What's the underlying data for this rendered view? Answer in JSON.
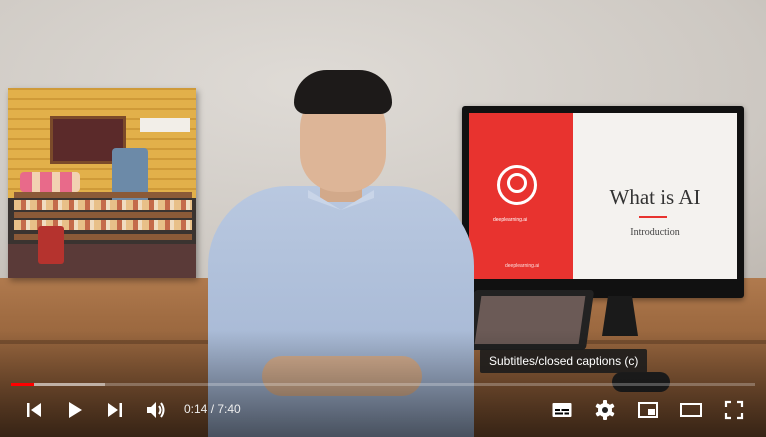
{
  "slide": {
    "brand": "deeplearning.ai",
    "footer": "deeplearning.ai",
    "title": "What is AI",
    "subtitle": "Introduction"
  },
  "player": {
    "tooltip": "Subtitles/closed captions (c)",
    "time_display": "0:14 / 7:40",
    "played_fraction": 0.0304,
    "buffered_fraction": 0.127,
    "accent_color": "#ff0000",
    "controls": [
      {
        "name": "previous",
        "icon": "skip-previous-icon"
      },
      {
        "name": "play",
        "icon": "play-icon"
      },
      {
        "name": "next",
        "icon": "skip-next-icon"
      },
      {
        "name": "mute",
        "icon": "volume-icon"
      },
      {
        "name": "subtitles",
        "icon": "subtitles-icon"
      },
      {
        "name": "settings",
        "icon": "gear-icon"
      },
      {
        "name": "miniplayer",
        "icon": "miniplayer-icon"
      },
      {
        "name": "theater",
        "icon": "theater-mode-icon"
      },
      {
        "name": "fullscreen",
        "icon": "fullscreen-icon"
      }
    ]
  }
}
